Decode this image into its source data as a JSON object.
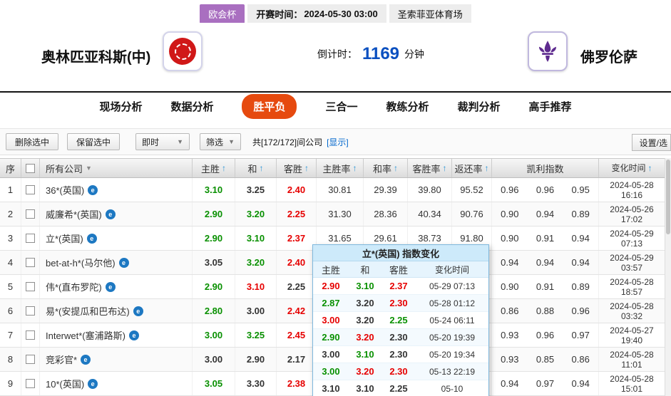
{
  "colors": {
    "accent_orange": "#e64a0f",
    "league_purple": "#a96fc0",
    "countdown_blue": "#0b50c0",
    "odds_up_red": "#e60000",
    "odds_down_green": "#089000",
    "link_blue": "#0066cc",
    "sort_arrow_blue": "#2b95d6"
  },
  "icons": {
    "sort_arrow": "↑",
    "dropdown_caret": "▼",
    "company_badge_glyph": "e",
    "checkbox_state": "unchecked"
  },
  "match_bar": {
    "league": "欧会杯",
    "kickoff_label": "开赛时间：",
    "kickoff_time": "2024-05-30 03:00",
    "venue": "圣索菲亚体育场"
  },
  "teams": {
    "home_name": "奥林匹亚科斯(中)",
    "away_name": "佛罗伦萨",
    "countdown_label": "倒计时：",
    "countdown_minutes": "1169",
    "countdown_unit": "分钟"
  },
  "nav_tabs": [
    {
      "label": "现场分析",
      "active": false
    },
    {
      "label": "数据分析",
      "active": false
    },
    {
      "label": "胜平负",
      "active": true
    },
    {
      "label": "三合一",
      "active": false
    },
    {
      "label": "教练分析",
      "active": false
    },
    {
      "label": "裁判分析",
      "active": false
    },
    {
      "label": "高手推荐",
      "active": false
    }
  ],
  "toolbar": {
    "delete_selected": "删除选中",
    "keep_selected": "保留选中",
    "time_filter": "即时",
    "filter": "筛选",
    "company_count": "共[172/172]间公司",
    "show_link": "[显示]",
    "settings": "设置/选"
  },
  "table": {
    "headers": {
      "index": "序",
      "company": "所有公司",
      "home": "主胜",
      "draw": "和",
      "away": "客胜",
      "home_rate": "主胜率",
      "draw_rate": "和率",
      "away_rate": "客胜率",
      "payout": "返还率",
      "kelly": "凯利指数",
      "change_time": "变化时间"
    },
    "rows": [
      {
        "index": "1",
        "company": "36*(英国)",
        "odds": [
          {
            "v": "3.10",
            "c": "g"
          },
          {
            "v": "3.25",
            "c": "k"
          },
          {
            "v": "2.40",
            "c": "r"
          }
        ],
        "rates": [
          "30.81",
          "29.39",
          "39.80",
          "95.52"
        ],
        "kelly": [
          "0.96",
          "0.96",
          "0.95"
        ],
        "date": "2024-05-28",
        "time": "16:16"
      },
      {
        "index": "2",
        "company": "威廉希*(英国)",
        "odds": [
          {
            "v": "2.90",
            "c": "g"
          },
          {
            "v": "3.20",
            "c": "g"
          },
          {
            "v": "2.25",
            "c": "r"
          }
        ],
        "rates": [
          "31.30",
          "28.36",
          "40.34",
          "90.76"
        ],
        "kelly": [
          "0.90",
          "0.94",
          "0.89"
        ],
        "date": "2024-05-26",
        "time": "17:02"
      },
      {
        "index": "3",
        "company": "立*(英国)",
        "odds": [
          {
            "v": "2.90",
            "c": "g"
          },
          {
            "v": "3.10",
            "c": "g"
          },
          {
            "v": "2.37",
            "c": "r"
          }
        ],
        "rates": [
          "31.65",
          "29.61",
          "38.73",
          "91.80"
        ],
        "kelly": [
          "0.90",
          "0.91",
          "0.94"
        ],
        "date": "2024-05-29",
        "time": "07:13"
      },
      {
        "index": "4",
        "company": "bet-at-h*(马尔他)",
        "odds": [
          {
            "v": "3.05",
            "c": "k"
          },
          {
            "v": "3.20",
            "c": "g"
          },
          {
            "v": "2.40",
            "c": "r"
          }
        ],
        "rates": [
          "",
          "",
          "",
          ""
        ],
        "kelly": [
          "0.94",
          "0.94",
          "0.94"
        ],
        "date": "2024-05-29",
        "time": "03:57"
      },
      {
        "index": "5",
        "company": "伟*(直布罗陀)",
        "odds": [
          {
            "v": "2.90",
            "c": "g"
          },
          {
            "v": "3.10",
            "c": "r"
          },
          {
            "v": "2.25",
            "c": "k"
          }
        ],
        "rates": [
          "",
          "",
          "",
          ""
        ],
        "kelly": [
          "0.90",
          "0.91",
          "0.89"
        ],
        "date": "2024-05-28",
        "time": "18:57"
      },
      {
        "index": "6",
        "company": "易*(安提瓜和巴布达)",
        "odds": [
          {
            "v": "2.80",
            "c": "g"
          },
          {
            "v": "3.00",
            "c": "k"
          },
          {
            "v": "2.42",
            "c": "r"
          }
        ],
        "rates": [
          "",
          "",
          "",
          ""
        ],
        "kelly": [
          "0.86",
          "0.88",
          "0.96"
        ],
        "date": "2024-05-28",
        "time": "03:32"
      },
      {
        "index": "7",
        "company": "Interwet*(塞浦路斯)",
        "odds": [
          {
            "v": "3.00",
            "c": "g"
          },
          {
            "v": "3.25",
            "c": "g"
          },
          {
            "v": "2.45",
            "c": "r"
          }
        ],
        "rates": [
          "",
          "",
          "",
          ""
        ],
        "kelly": [
          "0.93",
          "0.96",
          "0.97"
        ],
        "date": "2024-05-27",
        "time": "19:40"
      },
      {
        "index": "8",
        "company": "竞彩官*",
        "odds": [
          {
            "v": "3.00",
            "c": "k"
          },
          {
            "v": "2.90",
            "c": "k"
          },
          {
            "v": "2.17",
            "c": "k"
          }
        ],
        "rates": [
          "",
          "",
          "",
          ""
        ],
        "kelly": [
          "0.93",
          "0.85",
          "0.86"
        ],
        "date": "2024-05-28",
        "time": "11:01"
      },
      {
        "index": "9",
        "company": "10*(英国)",
        "odds": [
          {
            "v": "3.05",
            "c": "g"
          },
          {
            "v": "3.30",
            "c": "k"
          },
          {
            "v": "2.38",
            "c": "r"
          }
        ],
        "rates": [
          "",
          "",
          "",
          ""
        ],
        "kelly": [
          "0.94",
          "0.97",
          "0.94"
        ],
        "date": "2024-05-28",
        "time": "15:01"
      }
    ]
  },
  "popup": {
    "title": "立*(英国) 指数变化",
    "headers": [
      "主胜",
      "和",
      "客胜",
      "变化时间"
    ],
    "rows": [
      {
        "odds": [
          {
            "v": "2.90",
            "c": "r"
          },
          {
            "v": "3.10",
            "c": "g"
          },
          {
            "v": "2.37",
            "c": "r"
          }
        ],
        "time": "05-29 07:13"
      },
      {
        "odds": [
          {
            "v": "2.87",
            "c": "g"
          },
          {
            "v": "3.20",
            "c": "k"
          },
          {
            "v": "2.30",
            "c": "r"
          }
        ],
        "time": "05-28 01:12"
      },
      {
        "odds": [
          {
            "v": "3.00",
            "c": "r"
          },
          {
            "v": "3.20",
            "c": "k"
          },
          {
            "v": "2.25",
            "c": "g"
          }
        ],
        "time": "05-24 06:11"
      },
      {
        "odds": [
          {
            "v": "2.90",
            "c": "g"
          },
          {
            "v": "3.20",
            "c": "r"
          },
          {
            "v": "2.30",
            "c": "k"
          }
        ],
        "time": "05-20 19:39"
      },
      {
        "odds": [
          {
            "v": "3.00",
            "c": "k"
          },
          {
            "v": "3.10",
            "c": "g"
          },
          {
            "v": "2.30",
            "c": "k"
          }
        ],
        "time": "05-20 19:34"
      },
      {
        "odds": [
          {
            "v": "3.00",
            "c": "g"
          },
          {
            "v": "3.20",
            "c": "r"
          },
          {
            "v": "2.30",
            "c": "r"
          }
        ],
        "time": "05-13 22:19"
      },
      {
        "odds": [
          {
            "v": "3.10",
            "c": "k"
          },
          {
            "v": "3.10",
            "c": "k"
          },
          {
            "v": "2.25",
            "c": "k"
          }
        ],
        "time": "05-10"
      }
    ]
  }
}
